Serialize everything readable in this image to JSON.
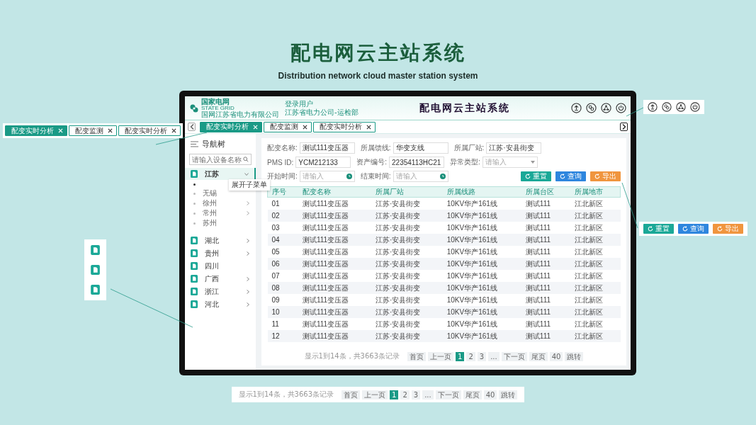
{
  "title": "配电网云主站系统",
  "subtitle": "Distribution network cloud master station system",
  "header": {
    "logo": [
      "国家电网",
      "STATE GRID",
      "国网江苏省电力有限公司"
    ],
    "user_label": "登录用户",
    "user_org": "江苏省电力公司-运检部",
    "title": "配电网云主站系统"
  },
  "tabs": [
    {
      "label": "配变实时分析",
      "selected": true
    },
    {
      "label": "配变监测",
      "selected": false
    },
    {
      "label": "配变实时分析",
      "selected": false
    }
  ],
  "nav": {
    "title": "导航树",
    "search": {
      "placeholder": "请输入设备名称"
    },
    "tooltip": "展开子菜单",
    "items": [
      {
        "label": "江苏",
        "selected": true,
        "expanded": true,
        "expandable": true,
        "children": [
          {
            "label": "无锡",
            "expandable": false
          },
          {
            "label": "徐州",
            "expandable": true
          },
          {
            "label": "常州",
            "expandable": true
          },
          {
            "label": "苏州",
            "expandable": false
          }
        ]
      },
      {
        "label": "湖北",
        "selected": false,
        "expanded": false,
        "expandable": true
      },
      {
        "label": "贵州",
        "selected": false,
        "expanded": false,
        "expandable": true
      },
      {
        "label": "四川",
        "selected": false,
        "expandable": false
      },
      {
        "label": "广西",
        "selected": false,
        "expanded": false,
        "expandable": true
      },
      {
        "label": "浙江",
        "selected": false,
        "expanded": false,
        "expandable": true
      },
      {
        "label": "河北",
        "selected": false,
        "expanded": false,
        "expandable": true
      }
    ]
  },
  "filters": [
    {
      "label": "配变名称:",
      "value": "测试111变压器",
      "kind": "text"
    },
    {
      "label": "所属馈线:",
      "value": "华变支线",
      "kind": "text"
    },
    {
      "label": "所属厂站:",
      "value": "江苏·安县街变",
      "kind": "text"
    },
    {
      "label": "PMS ID:",
      "value": "YCM212133",
      "kind": "text"
    },
    {
      "label": "资产编号:",
      "value": "22354113HC21",
      "kind": "text"
    },
    {
      "label": "异常类型:",
      "placeholder": "请输入",
      "kind": "select"
    },
    {
      "label": "开始时间:",
      "placeholder": "请输入",
      "kind": "date"
    },
    {
      "label": "结束时间:",
      "placeholder": "请输入",
      "kind": "date"
    }
  ],
  "buttons": [
    {
      "label": "重置",
      "color": "#1aa897"
    },
    {
      "label": "查询",
      "color": "#2e86de"
    },
    {
      "label": "导出",
      "color": "#f0953e"
    }
  ],
  "table": {
    "columns": [
      "序号",
      "配变名称",
      "所属厂站",
      "所属线路",
      "所属台区",
      "所属地市"
    ],
    "rows": [
      [
        "01",
        "测试111变压器",
        "江苏·安县街变",
        "10KV华产161线",
        "测试111",
        "江北新区"
      ],
      [
        "02",
        "测试111变压器",
        "江苏·安县街变",
        "10KV华产161线",
        "测试111",
        "江北新区"
      ],
      [
        "03",
        "测试111变压器",
        "江苏·安县街变",
        "10KV华产161线",
        "测试111",
        "江北新区"
      ],
      [
        "04",
        "测试111变压器",
        "江苏·安县街变",
        "10KV华产161线",
        "测试111",
        "江北新区"
      ],
      [
        "05",
        "测试111变压器",
        "江苏·安县街变",
        "10KV华产161线",
        "测试111",
        "江北新区"
      ],
      [
        "06",
        "测试111变压器",
        "江苏·安县街变",
        "10KV华产161线",
        "测试111",
        "江北新区"
      ],
      [
        "07",
        "测试111变压器",
        "江苏·安县街变",
        "10KV华产161线",
        "测试111",
        "江北新区"
      ],
      [
        "08",
        "测试111变压器",
        "江苏·安县街变",
        "10KV华产161线",
        "测试111",
        "江北新区"
      ],
      [
        "09",
        "测试111变压器",
        "江苏·安县街变",
        "10KV华产161线",
        "测试111",
        "江北新区"
      ],
      [
        "10",
        "测试111变压器",
        "江苏·安县街变",
        "10KV华产161线",
        "测试111",
        "江北新区"
      ],
      [
        "11",
        "测试111变压器",
        "江苏·安县街变",
        "10KV华产161线",
        "测试111",
        "江北新区"
      ],
      [
        "12",
        "测试111变压器",
        "江苏·安县街变",
        "10KV华产161线",
        "测试111",
        "江北新区"
      ]
    ]
  },
  "pagination": {
    "summary": "显示1到14条，共3663条记录",
    "items": [
      {
        "label": "首页",
        "selected": false
      },
      {
        "label": "上一页",
        "selected": false
      },
      {
        "label": "1",
        "selected": true
      },
      {
        "label": "2",
        "selected": false
      },
      {
        "label": "3",
        "selected": false
      },
      {
        "label": "...",
        "selected": false
      },
      {
        "label": "下一页",
        "selected": false
      },
      {
        "label": "尾页",
        "selected": false
      },
      {
        "label": "40",
        "selected": false
      },
      {
        "label": "跳转",
        "selected": false
      }
    ]
  },
  "callouts": {
    "tabs": [
      {
        "label": "配变实时分析",
        "selected": true
      },
      {
        "label": "配变监测",
        "selected": false
      },
      {
        "label": "配变实时分析",
        "selected": false
      }
    ],
    "buttons": [
      {
        "label": "重置",
        "color": "#1aa897"
      },
      {
        "label": "查询",
        "color": "#2e86de"
      },
      {
        "label": "导出",
        "color": "#f0953e"
      }
    ],
    "pagination": {
      "summary": "显示1到14条，共3663条记录",
      "items": [
        {
          "label": "首页",
          "selected": false
        },
        {
          "label": "上一页",
          "selected": false
        },
        {
          "label": "1",
          "selected": true
        },
        {
          "label": "2",
          "selected": false
        },
        {
          "label": "3",
          "selected": false
        },
        {
          "label": "...",
          "selected": false
        },
        {
          "label": "下一页",
          "selected": false
        },
        {
          "label": "尾页",
          "selected": false
        },
        {
          "label": "40",
          "selected": false
        },
        {
          "label": "跳转",
          "selected": false
        }
      ]
    }
  }
}
